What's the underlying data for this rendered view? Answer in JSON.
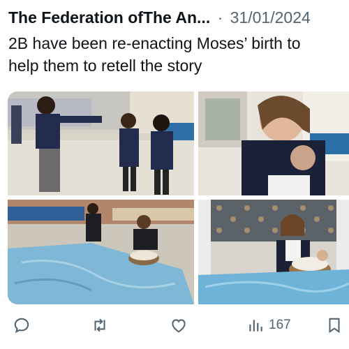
{
  "post": {
    "author": "The Federation ofThe An...",
    "separator": "·",
    "date": "31/01/2024",
    "text_lines": [
      "2B have been re-enacting Moses’ birth to",
      "help them to retell the story"
    ]
  },
  "media": [
    {
      "alt": "photo-1"
    },
    {
      "alt": "photo-2"
    },
    {
      "alt": "photo-3"
    },
    {
      "alt": "photo-4"
    }
  ],
  "actions": {
    "views": "167"
  },
  "colors": {
    "text": "#0f1419",
    "muted": "#536471",
    "mat": "#7fb8d6"
  }
}
